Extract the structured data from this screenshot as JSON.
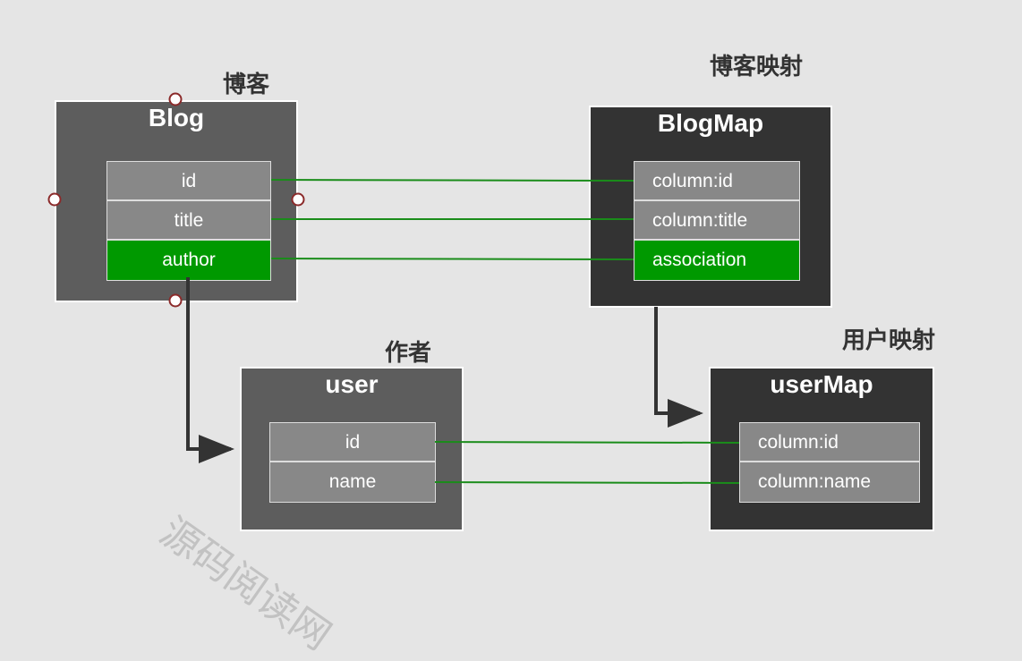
{
  "labels": {
    "blog": "博客",
    "blog_map": "博客映射",
    "author": "作者",
    "user_map": "用户映射"
  },
  "boxes": {
    "blog": {
      "title": "Blog",
      "fields": [
        "id",
        "title",
        "author"
      ],
      "highlight_field": "author"
    },
    "blog_map": {
      "title": "BlogMap",
      "fields": [
        "column:id",
        "column:title",
        "association"
      ],
      "highlight_field": "association"
    },
    "user": {
      "title": "user",
      "fields": [
        "id",
        "name"
      ]
    },
    "user_map": {
      "title": "userMap",
      "fields": [
        "column:id",
        "column:name"
      ]
    }
  },
  "colors": {
    "background": "#e5e5e5",
    "entity_box": "#5d5d5d",
    "map_box": "#333333",
    "field": "#888888",
    "highlight": "#009900",
    "link_line": "#1a8c1a",
    "arrow": "#333333",
    "handle_stroke": "#8b2a2a"
  },
  "watermark": "源码阅读网"
}
